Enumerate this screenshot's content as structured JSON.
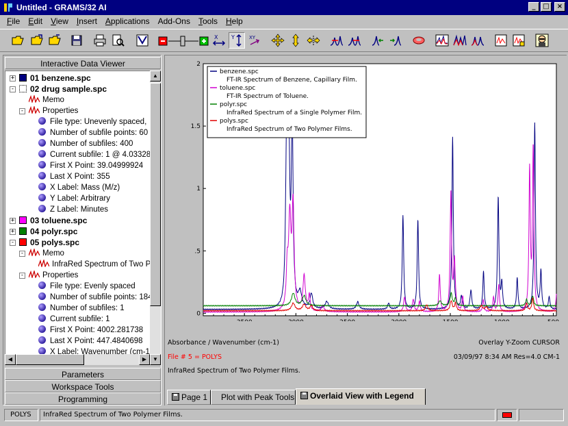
{
  "window": {
    "title": "Untitled - GRAMS/32 AI",
    "controls": [
      "_",
      "□",
      "×"
    ]
  },
  "menu": {
    "items": [
      {
        "u": "F",
        "rest": "ile"
      },
      {
        "u": "E",
        "rest": "dit"
      },
      {
        "u": "V",
        "rest": "iew"
      },
      {
        "u": "I",
        "rest": "nsert"
      },
      {
        "u": "A",
        "rest": "pplications"
      },
      {
        "u": "",
        "rest": "Add-Ons"
      },
      {
        "u": "T",
        "rest": "ools"
      },
      {
        "u": "H",
        "rest": "elp"
      }
    ]
  },
  "toolbar": {
    "icons": [
      "open-folder-icon",
      "open-folder-icon",
      "open-folder-icon",
      "save-icon",
      "print-icon",
      "print-preview-icon",
      "plot-setup-icon",
      "zoom-slider",
      "x-scale-icon",
      "y-scale-icon",
      "xy-scale-icon",
      "pan-icon",
      "vertical-arrows-icon",
      "horizontal-arrows-icon",
      "peak-icon",
      "peak-icon",
      "shift-left-icon",
      "shift-right-icon",
      "overlay-icon",
      "spectra-icon",
      "spectra-icon",
      "spectra-icon",
      "report-icon",
      "report-icon",
      "expert-icon"
    ]
  },
  "left_panel": {
    "header": "Interactive Data Viewer",
    "tree": [
      {
        "level": 0,
        "type": "file",
        "expander": "+",
        "color": "#000080",
        "text": "01  benzene.spc"
      },
      {
        "level": 0,
        "type": "file",
        "expander": "-",
        "color": "dotted",
        "text": "02  drug sample.spc"
      },
      {
        "level": 1,
        "type": "spec",
        "expander": "",
        "text": "Memo"
      },
      {
        "level": 1,
        "type": "spec",
        "expander": "-",
        "text": "Properties"
      },
      {
        "level": 2,
        "type": "prop",
        "text": "File type: Unevenly spaced,"
      },
      {
        "level": 2,
        "type": "prop",
        "text": "Number of subfile points: 60"
      },
      {
        "level": 2,
        "type": "prop",
        "text": "Number of subfiles: 400"
      },
      {
        "level": 2,
        "type": "prop",
        "text": "Current subfile: 1 @ 4.03328"
      },
      {
        "level": 2,
        "type": "prop",
        "text": "First X Point: 39.04999924"
      },
      {
        "level": 2,
        "type": "prop",
        "text": "Last X Point: 355"
      },
      {
        "level": 2,
        "type": "prop",
        "text": "X Label: Mass (M/z)"
      },
      {
        "level": 2,
        "type": "prop",
        "text": "Y Label: Arbitrary"
      },
      {
        "level": 2,
        "type": "prop",
        "text": "Z Label: Minutes"
      },
      {
        "level": 0,
        "type": "file",
        "expander": "+",
        "color": "#ff00ff",
        "text": "03  toluene.spc"
      },
      {
        "level": 0,
        "type": "file",
        "expander": "+",
        "color": "#008000",
        "text": "04  polyr.spc"
      },
      {
        "level": 0,
        "type": "file",
        "expander": "-",
        "color": "#ff0000",
        "text": "05  polys.spc"
      },
      {
        "level": 1,
        "type": "spec",
        "expander": "-",
        "text": "Memo"
      },
      {
        "level": 2,
        "type": "spec",
        "text": "InfraRed Spectrum of Two P"
      },
      {
        "level": 1,
        "type": "spec",
        "expander": "-",
        "text": "Properties"
      },
      {
        "level": 2,
        "type": "prop",
        "text": "File type: Evenly spaced"
      },
      {
        "level": 2,
        "type": "prop",
        "text": "Number of subfile points: 184"
      },
      {
        "level": 2,
        "type": "prop",
        "text": "Number of subfiles: 1"
      },
      {
        "level": 2,
        "type": "prop",
        "text": "Current subfile: 1"
      },
      {
        "level": 2,
        "type": "prop",
        "text": "First X Point: 4002.281738"
      },
      {
        "level": 2,
        "type": "prop",
        "text": "Last X Point: 447.4840698"
      },
      {
        "level": 2,
        "type": "prop",
        "text": "X Label: Wavenumber (cm-1"
      }
    ],
    "tabs": [
      "Parameters",
      "Workspace Tools",
      "Programming"
    ]
  },
  "view": {
    "axis_label": "Absorbance / Wavenumber (cm-1)",
    "mode_label": "Overlay Y-Zoom CURSOR",
    "file_label": "File # 5 = POLYS",
    "file_color": "#ff0000",
    "date_label": "03/09/97  8:34 AM  Res=4.0 CM-1",
    "memo_label": "InfraRed Spectrum of Two Polymer Films.",
    "tabs": [
      "Page 1",
      "Plot with Peak Tools",
      "Overlaid View with Legend"
    ],
    "active_tab": 2
  },
  "status": {
    "file": "POLYS",
    "message": "InfraRed Spectrum of Two Polymer Films.",
    "indicator_color": "#ff0000"
  },
  "chart_data": {
    "type": "line",
    "xlabel": "",
    "ylabel": "",
    "xlim": [
      3900,
      470
    ],
    "ylim": [
      -0.02,
      2.0
    ],
    "x_ticks": [
      3500,
      3000,
      2500,
      2000,
      1500,
      1000,
      500
    ],
    "x_tick_labels": [
      "3500",
      "3000",
      "2500",
      "2000",
      "1500",
      "1000",
      "500"
    ],
    "y_ticks": [
      0,
      0.5,
      1,
      1.5,
      2
    ],
    "y_tick_labels": [
      "0",
      ".5",
      "1",
      "1.5",
      "2"
    ],
    "legend_position": "top-left",
    "legend": [
      {
        "name": "benzene.spc",
        "desc": "FT-IR Spectrum of Benzene, Capillary Film.",
        "color": "#000080"
      },
      {
        "name": "toluene.spc",
        "desc": "FT-IR Spectrum of Toluene.",
        "color": "#d000d0"
      },
      {
        "name": "polyr.spc",
        "desc": "InfraRed Spectrum of a Single Polymer Film.",
        "color": "#008000"
      },
      {
        "name": "polys.spc",
        "desc": "InfraRed Spectrum of Two Polymer Films.",
        "color": "#e00000"
      }
    ],
    "series": [
      {
        "name": "benzene.spc",
        "color": "#000080",
        "baseline": 0.03,
        "peaks": [
          [
            3092,
            1.1,
            10
          ],
          [
            3071,
            1.4,
            12
          ],
          [
            3036,
            1.45,
            10
          ],
          [
            2960,
            0.12,
            20
          ],
          [
            2850,
            0.12,
            15
          ],
          [
            2700,
            0.06,
            20
          ],
          [
            2400,
            0.06,
            15
          ],
          [
            2100,
            0.05,
            10
          ],
          [
            1960,
            0.75,
            8
          ],
          [
            1815,
            0.72,
            8
          ],
          [
            1478,
            1.38,
            8
          ],
          [
            1392,
            0.1,
            10
          ],
          [
            1300,
            0.15,
            10
          ],
          [
            1178,
            0.3,
            8
          ],
          [
            1035,
            0.9,
            8
          ],
          [
            1000,
            0.2,
            8
          ],
          [
            850,
            0.25,
            8
          ],
          [
            680,
            1.49,
            8
          ],
          [
            620,
            0.3,
            8
          ],
          [
            540,
            0.1,
            8
          ]
        ]
      },
      {
        "name": "toluene.spc",
        "color": "#d000d0",
        "baseline": 0.01,
        "peaks": [
          [
            3085,
            0.3,
            10
          ],
          [
            3060,
            0.72,
            14
          ],
          [
            3028,
            0.82,
            12
          ],
          [
            2920,
            0.28,
            14
          ],
          [
            2870,
            0.12,
            10
          ],
          [
            2740,
            0.05,
            15
          ],
          [
            1945,
            0.12,
            10
          ],
          [
            1860,
            0.1,
            10
          ],
          [
            1800,
            0.08,
            10
          ],
          [
            1605,
            0.3,
            8
          ],
          [
            1495,
            0.95,
            8
          ],
          [
            1460,
            0.4,
            10
          ],
          [
            1380,
            0.12,
            8
          ],
          [
            1180,
            0.1,
            8
          ],
          [
            1080,
            0.12,
            8
          ],
          [
            1030,
            0.22,
            8
          ],
          [
            730,
            1.12,
            8
          ],
          [
            695,
            1.3,
            8
          ],
          [
            465,
            0.2,
            8
          ]
        ]
      },
      {
        "name": "polyr.spc",
        "color": "#008000",
        "baseline": 0.06,
        "peaks": [
          [
            3026,
            0.1,
            20
          ],
          [
            2920,
            0.08,
            20
          ],
          [
            1600,
            0.04,
            15
          ],
          [
            1492,
            0.1,
            12
          ],
          [
            1450,
            0.06,
            10
          ],
          [
            760,
            0.05,
            10
          ],
          [
            700,
            0.08,
            10
          ]
        ]
      },
      {
        "name": "polys.spc",
        "color": "#e00000",
        "baseline": 0.02,
        "peaks": [
          [
            3026,
            0.06,
            20
          ],
          [
            2920,
            0.05,
            20
          ],
          [
            2850,
            0.04,
            15
          ],
          [
            1730,
            0.05,
            12
          ],
          [
            1492,
            0.08,
            12
          ],
          [
            1450,
            0.06,
            10
          ],
          [
            1200,
            0.04,
            15
          ],
          [
            1150,
            0.03,
            15
          ],
          [
            760,
            0.06,
            10
          ],
          [
            700,
            0.1,
            10
          ]
        ]
      }
    ]
  }
}
